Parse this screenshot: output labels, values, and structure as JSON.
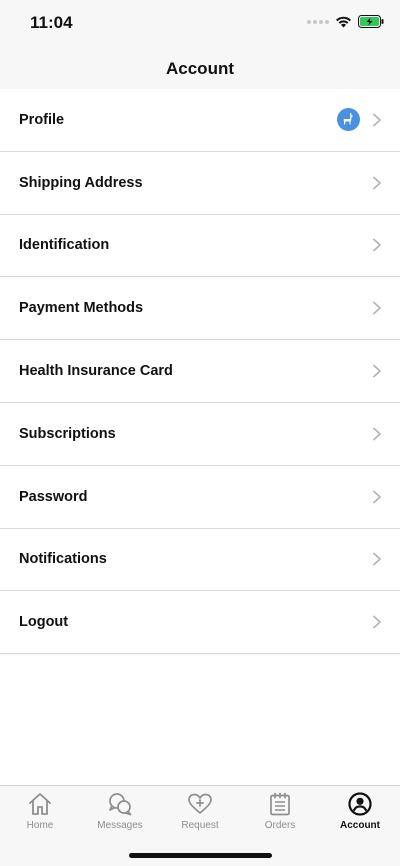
{
  "status": {
    "time": "11:04"
  },
  "header": {
    "title": "Account"
  },
  "items": [
    {
      "label": "Profile"
    },
    {
      "label": "Shipping Address"
    },
    {
      "label": "Identification"
    },
    {
      "label": "Payment Methods"
    },
    {
      "label": "Health Insurance Card"
    },
    {
      "label": "Subscriptions"
    },
    {
      "label": "Password"
    },
    {
      "label": "Notifications"
    },
    {
      "label": "Logout"
    }
  ],
  "tabs": [
    {
      "label": "Home",
      "icon": "home-icon"
    },
    {
      "label": "Messages",
      "icon": "messages-icon"
    },
    {
      "label": "Request",
      "icon": "heart-plus-icon"
    },
    {
      "label": "Orders",
      "icon": "calendar-icon"
    },
    {
      "label": "Account",
      "icon": "account-icon",
      "active": true
    }
  ],
  "colors": {
    "accent": "#4a90e2",
    "battery": "#34c759",
    "inactive_tab": "#8e8e8e"
  }
}
